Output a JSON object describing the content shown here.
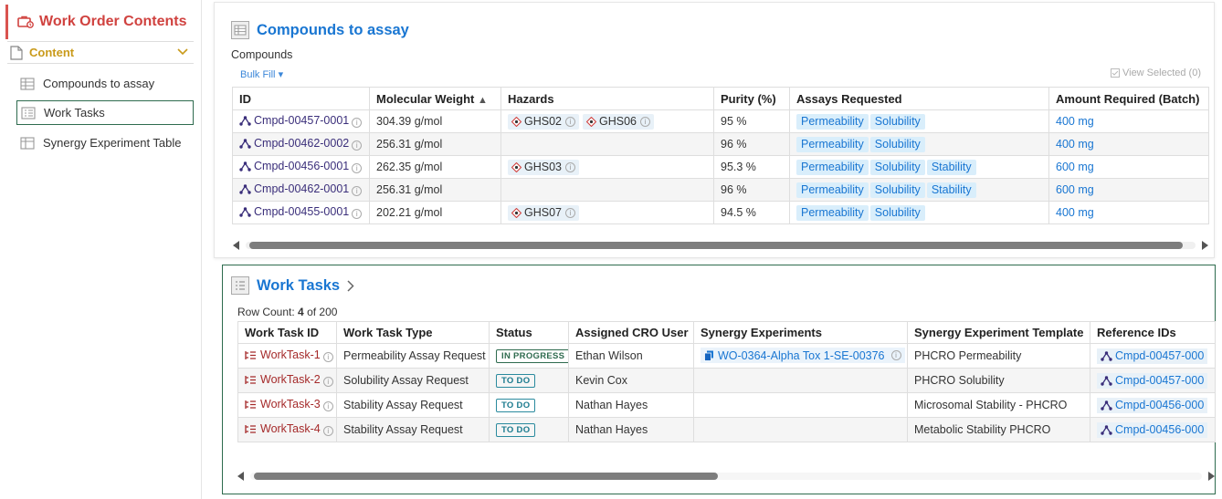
{
  "sidebar": {
    "title": "Work Order Contents",
    "section": "Content",
    "items": [
      {
        "label": "Compounds to assay"
      },
      {
        "label": "Work Tasks"
      },
      {
        "label": "Synergy Experiment Table"
      }
    ]
  },
  "compounds": {
    "title": "Compounds to assay",
    "subtitle": "Compounds",
    "bulk_fill": "Bulk Fill",
    "view_selected": "View Selected (0)",
    "columns": [
      "ID",
      "Molecular Weight",
      "Hazards",
      "Purity (%)",
      "Assays Requested",
      "Amount Required (Batch)"
    ],
    "rows": [
      {
        "id": "Cmpd-00457-0001",
        "mw": "304.39 g/mol",
        "hazards": [
          "GHS02",
          "GHS06"
        ],
        "purity": "95 %",
        "assays": [
          "Permeability",
          "Solubility"
        ],
        "amount": "400 mg"
      },
      {
        "id": "Cmpd-00462-0002",
        "mw": "256.31 g/mol",
        "hazards": [],
        "purity": "96 %",
        "assays": [
          "Permeability",
          "Solubility"
        ],
        "amount": "400 mg"
      },
      {
        "id": "Cmpd-00456-0001",
        "mw": "262.35 g/mol",
        "hazards": [
          "GHS03"
        ],
        "purity": "95.3 %",
        "assays": [
          "Permeability",
          "Solubility",
          "Stability"
        ],
        "amount": "600 mg"
      },
      {
        "id": "Cmpd-00462-0001",
        "mw": "256.31 g/mol",
        "hazards": [],
        "purity": "96 %",
        "assays": [
          "Permeability",
          "Solubility",
          "Stability"
        ],
        "amount": "600 mg"
      },
      {
        "id": "Cmpd-00455-0001",
        "mw": "202.21 g/mol",
        "hazards": [
          "GHS07"
        ],
        "purity": "94.5 %",
        "assays": [
          "Permeability",
          "Solubility"
        ],
        "amount": "400 mg"
      }
    ]
  },
  "worktasks": {
    "title": "Work Tasks",
    "row_count_label": "Row Count:",
    "row_count": "4",
    "row_total": "of 200",
    "columns": [
      "Work Task ID",
      "Work Task Type",
      "Status",
      "Assigned CRO User",
      "Synergy Experiments",
      "Synergy Experiment Template",
      "Reference IDs"
    ],
    "rows": [
      {
        "id": "WorkTask-1",
        "type": "Permeability Assay Request",
        "status": "IN PROGRESS",
        "user": "Ethan Wilson",
        "experiment": "WO-0364-Alpha Tox 1-SE-00376",
        "template": "PHCRO Permeability",
        "ref": "Cmpd-00457-000"
      },
      {
        "id": "WorkTask-2",
        "type": "Solubility Assay Request",
        "status": "TO DO",
        "user": "Kevin Cox",
        "experiment": "",
        "template": "PHCRO Solubility",
        "ref": "Cmpd-00457-000"
      },
      {
        "id": "WorkTask-3",
        "type": "Stability Assay Request",
        "status": "TO DO",
        "user": "Nathan Hayes",
        "experiment": "",
        "template": "Microsomal Stability - PHCRO",
        "ref": "Cmpd-00456-000"
      },
      {
        "id": "WorkTask-4",
        "type": "Stability Assay Request",
        "status": "TO DO",
        "user": "Nathan Hayes",
        "experiment": "",
        "template": "Metabolic Stability PHCRO",
        "ref": "Cmpd-00456-000"
      }
    ]
  },
  "colors": {
    "accent": "#1976d2",
    "brand_red": "#d0423f",
    "section_gold": "#c99a1a",
    "active_border": "#2e6b4e",
    "chip_bg": "#d9eefb"
  }
}
